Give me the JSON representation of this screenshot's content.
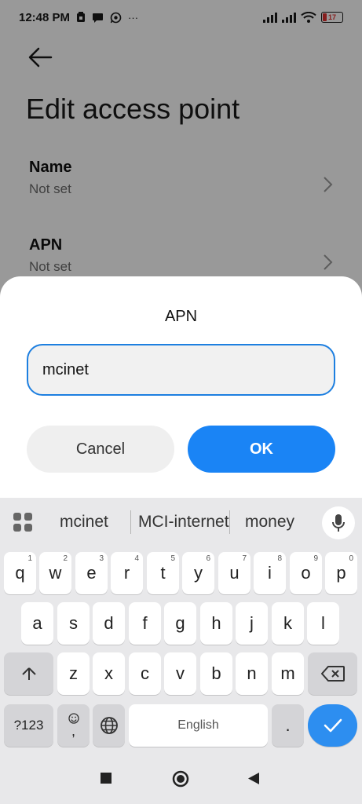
{
  "status_bar": {
    "time": "12:48 PM",
    "battery_level": "17",
    "more_indicator": "···"
  },
  "page": {
    "title": "Edit access point"
  },
  "settings": [
    {
      "label": "Name",
      "value": "Not set"
    },
    {
      "label": "APN",
      "value": "Not set"
    }
  ],
  "dialog": {
    "title": "APN",
    "input_value": "mcinet",
    "cancel_label": "Cancel",
    "ok_label": "OK"
  },
  "keyboard": {
    "suggestions": [
      "mcinet",
      "MCI-internet",
      "money"
    ],
    "row1": [
      {
        "key": "q",
        "hint": "1"
      },
      {
        "key": "w",
        "hint": "2"
      },
      {
        "key": "e",
        "hint": "3"
      },
      {
        "key": "r",
        "hint": "4"
      },
      {
        "key": "t",
        "hint": "5"
      },
      {
        "key": "y",
        "hint": "6"
      },
      {
        "key": "u",
        "hint": "7"
      },
      {
        "key": "i",
        "hint": "8"
      },
      {
        "key": "o",
        "hint": "9"
      },
      {
        "key": "p",
        "hint": "0"
      }
    ],
    "row2": [
      "a",
      "s",
      "d",
      "f",
      "g",
      "h",
      "j",
      "k",
      "l"
    ],
    "row3": [
      "z",
      "x",
      "c",
      "v",
      "b",
      "n",
      "m"
    ],
    "symbols_label": "?123",
    "emoji_comma_label": ",",
    "space_label": "English",
    "period_label": "."
  },
  "colors": {
    "accent": "#1a84f5",
    "input_border": "#1d7fe0",
    "battery_low": "#e03131"
  }
}
